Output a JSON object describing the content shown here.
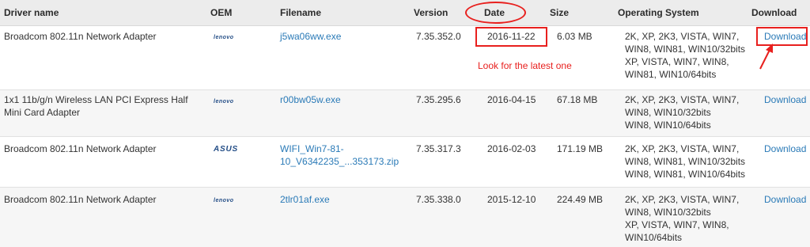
{
  "columns": {
    "driver_name": "Driver name",
    "oem": "OEM",
    "filename": "Filename",
    "version": "Version",
    "date": "Date",
    "size": "Size",
    "os": "Operating System",
    "download": "Download"
  },
  "rows": [
    {
      "driver": [
        "Broadcom 802.11n Network Adapter"
      ],
      "oem": "lenovo",
      "filename": [
        "j5wa06ww.exe"
      ],
      "version": "7.35.352.0",
      "date": "2016-11-22",
      "size": "6.03 MB",
      "os": [
        "2K, XP, 2K3, VISTA, WIN7,",
        "WIN8, WIN81, WIN10/32bits",
        "XP, VISTA, WIN7, WIN8,",
        "WIN81, WIN10/64bits"
      ],
      "download": "Download"
    },
    {
      "driver": [
        "1x1 11b/g/n Wireless LAN PCI Express Half",
        "Mini Card Adapter"
      ],
      "oem": "lenovo",
      "filename": [
        "r00bw05w.exe"
      ],
      "version": "7.35.295.6",
      "date": "2016-04-15",
      "size": "67.18 MB",
      "os": [
        "2K, XP, 2K3, VISTA, WIN7,",
        "WIN8, WIN10/32bits",
        "WIN8, WIN10/64bits"
      ],
      "download": "Download"
    },
    {
      "driver": [
        "Broadcom 802.11n Network Adapter"
      ],
      "oem": "ASUS",
      "filename": [
        "WIFI_Win7-81-",
        "10_V6342235_...353173.zip"
      ],
      "version": "7.35.317.3",
      "date": "2016-02-03",
      "size": "171.19 MB",
      "os": [
        "2K, XP, 2K3, VISTA, WIN7,",
        "WIN8, WIN81, WIN10/32bits",
        "WIN8, WIN81, WIN10/64bits"
      ],
      "download": "Download"
    },
    {
      "driver": [
        "Broadcom 802.11n Network Adapter"
      ],
      "oem": "lenovo",
      "filename": [
        "2tlr01af.exe"
      ],
      "version": "7.35.338.0",
      "date": "2015-12-10",
      "size": "224.49 MB",
      "os": [
        "2K, XP, 2K3, VISTA, WIN7,",
        "WIN8, WIN10/32bits",
        "XP, VISTA, WIN7, WIN8,",
        "WIN10/64bits"
      ],
      "download": "Download"
    }
  ],
  "annotation": {
    "note": "Look for the latest one",
    "color": "#e8201e"
  },
  "colors": {
    "link": "#2a7ab7",
    "header_bg": "#ececec",
    "alt_row_bg": "#f6f6f6",
    "oem_logo": "#234d86"
  }
}
